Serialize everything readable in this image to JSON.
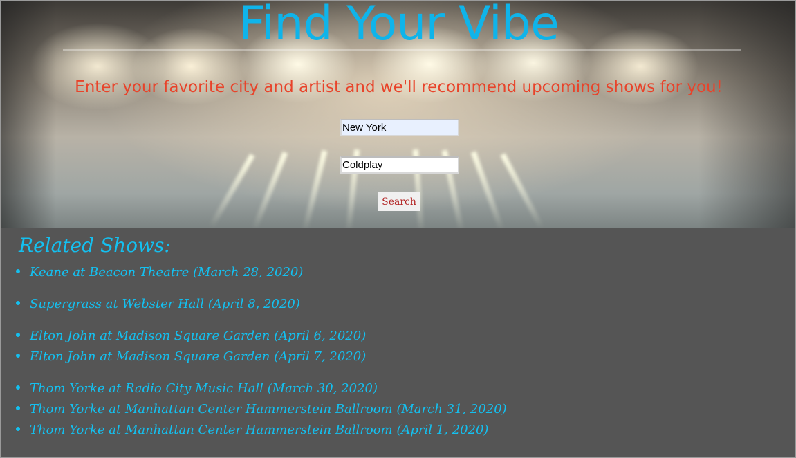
{
  "hero": {
    "title": "Find Your Vibe",
    "subtitle": "Enter your favorite city and artist and we'll recommend upcoming shows for you!",
    "city_value": "New York",
    "artist_value": "Coldplay",
    "search_label": "Search"
  },
  "results": {
    "heading": "Related Shows:",
    "shows": [
      "Keane at Beacon Theatre (March 28, 2020)",
      "Supergrass at Webster Hall (April 8, 2020)",
      "Elton John at Madison Square Garden (April 6, 2020)",
      "Elton John at Madison Square Garden (April 7, 2020)",
      "Thom Yorke at Radio City Music Hall (March 30, 2020)",
      "Thom Yorke at Manhattan Center Hammerstein Ballroom (March 31, 2020)",
      "Thom Yorke at Manhattan Center Hammerstein Ballroom (April 1, 2020)"
    ]
  },
  "colors": {
    "title": "#0fb4ea",
    "subtitle": "#e8432a",
    "results_text": "#14c0f0",
    "results_background": "#555555",
    "search_text": "#b22222"
  }
}
